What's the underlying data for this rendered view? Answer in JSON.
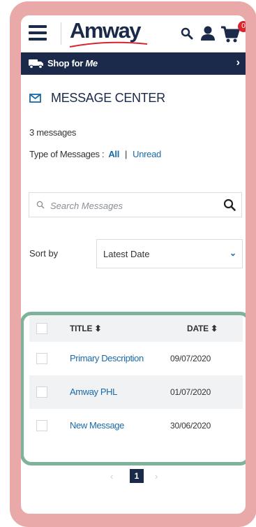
{
  "header": {
    "logo_text": "Amway",
    "cart_count": "0"
  },
  "shop_bar": {
    "label_prefix": "Shop for ",
    "label_suffix": "Me",
    "chevron": "›"
  },
  "message_center": {
    "title": "MESSAGE CENTER",
    "count_text": "3 messages",
    "type_label": "Type of Messages :",
    "filter_all": "All",
    "filter_separator": "|",
    "filter_unread": "Unread"
  },
  "search": {
    "placeholder": "Search Messages"
  },
  "sort": {
    "label": "Sort by",
    "selected": "Latest Date"
  },
  "table": {
    "columns": [
      "TITLE",
      "DATE"
    ],
    "rows": [
      {
        "title": "Primary Description",
        "date": "09/07/2020"
      },
      {
        "title": "Amway PHL",
        "date": "01/07/2020"
      },
      {
        "title": "New Message",
        "date": "30/06/2020"
      }
    ]
  },
  "pagination": {
    "prev": "‹",
    "current": "1",
    "next": "›"
  },
  "colors": {
    "navy": "#1b2a4a",
    "link_blue": "#1a6aa8",
    "badge_red": "#d9262e",
    "frame_pink": "#e9a9a8",
    "highlight_green": "#7fb29a"
  }
}
